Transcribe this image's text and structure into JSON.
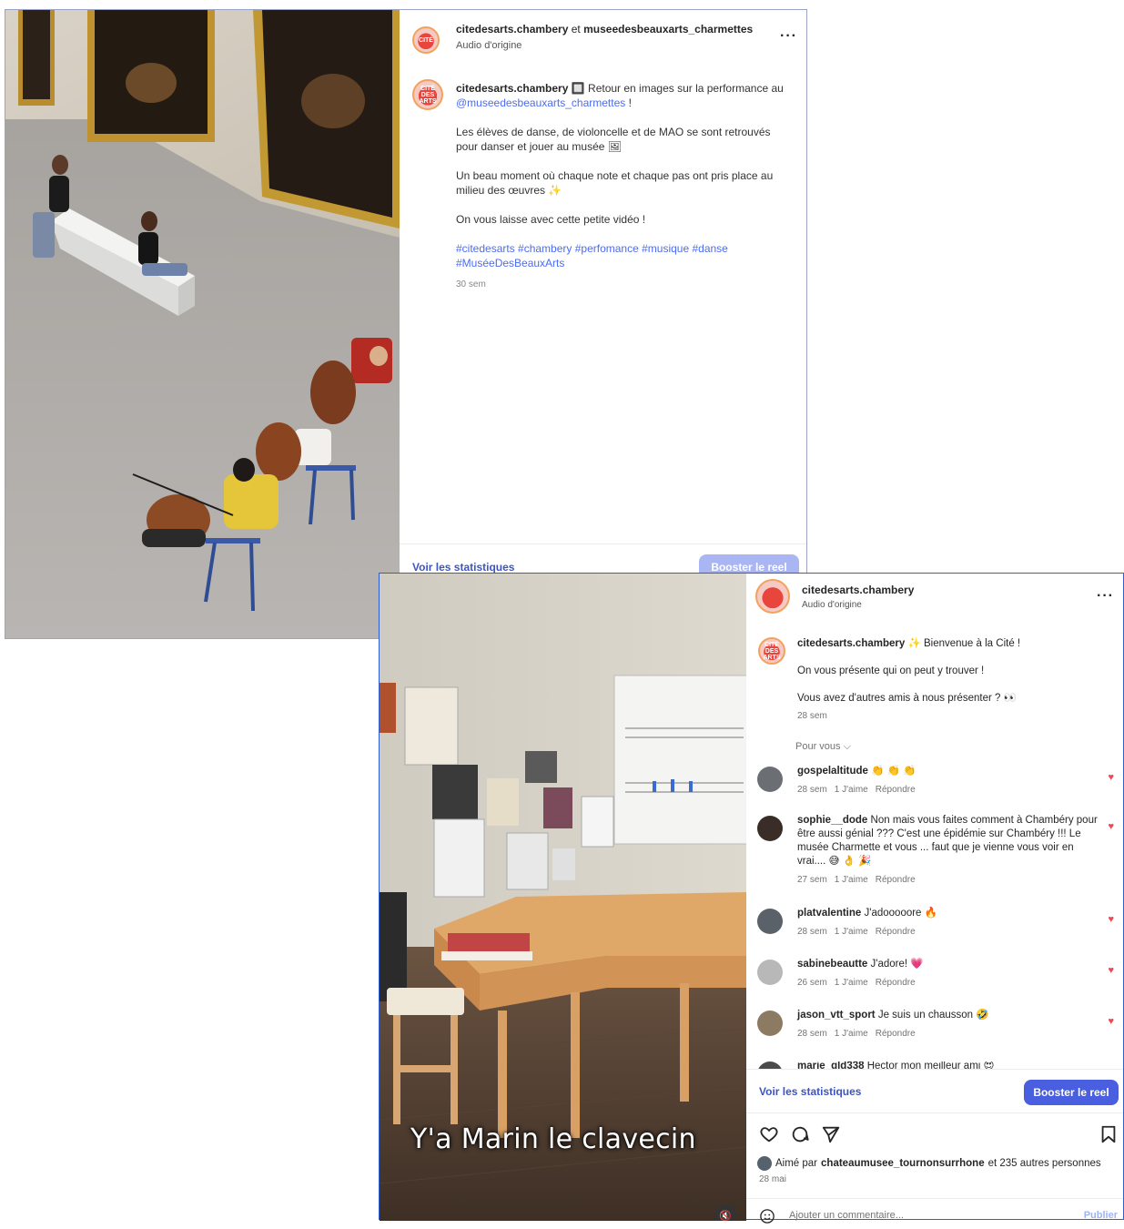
{
  "post1": {
    "header": {
      "author": "citedesarts.chambery",
      "joiner": "et",
      "coauthor": "museedesbeauxarts_charmettes",
      "audio": "Audio d'origine"
    },
    "caption": {
      "author": "citedesarts.chambery",
      "line1": "🔲 Retour en images sur la performance au",
      "mention": "@museedesbeauxarts_charmettes",
      "line1_end": "!",
      "para2": "Les élèves de danse, de violoncelle et de MAO se sont retrouvés pour danser et jouer au musée 🖼",
      "para3": "Un beau moment où chaque note et chaque pas ont pris place au milieu des œuvres ✨",
      "para4": "On vous laisse avec cette petite vidéo !",
      "hashtags": "#citedesarts #chambery #perfomance #musique #danse #MuséeDesBeauxArts",
      "time": "30 sem"
    },
    "stats_link": "Voir les statistiques",
    "boost_label": "Booster le reel",
    "boost_color": "#a9b6f3"
  },
  "post2": {
    "header": {
      "author": "citedesarts.chambery",
      "audio": "Audio d'origine"
    },
    "caption": {
      "author": "citedesarts.chambery",
      "line1": "✨ Bienvenue à la Cité !",
      "para2": "On vous présente qui on peut y trouver !",
      "para3": "Vous avez d'autres amis à nous présenter ? 👀",
      "time": "28 sem"
    },
    "for_you": "Pour vous ⌵",
    "comments": [
      {
        "user": "gospelaltitude",
        "text": "👏 👏 👏",
        "time": "28 sem",
        "likes": "1 J'aime",
        "reply": "Répondre"
      },
      {
        "user": "sophie__dode",
        "text": "Non mais vous faites comment à Chambéry pour être aussi génial ??? C'est une épidémie sur Chambéry !!! Le musée Charmette et vous ... faut que je vienne vous voir en vrai.... 😅 👌 🎉",
        "time": "27 sem",
        "likes": "1 J'aime",
        "reply": "Répondre"
      },
      {
        "user": "platvalentine",
        "text": "J'adooooore 🔥",
        "time": "28 sem",
        "likes": "1 J'aime",
        "reply": "Répondre"
      },
      {
        "user": "sabinebeautte",
        "text": "J'adore! 💗",
        "time": "26 sem",
        "likes": "1 J'aime",
        "reply": "Répondre"
      },
      {
        "user": "jason_vtt_sport",
        "text": "Je suis un chausson 🤣",
        "time": "28 sem",
        "likes": "1 J'aime",
        "reply": "Répondre"
      },
      {
        "user": "marie_gld338",
        "text": "Hector mon meilleur ami 😍",
        "time": "",
        "likes": "",
        "reply": ""
      }
    ],
    "video_overlay": "Y'a Marin le clavecin",
    "stats_link": "Voir les statistiques",
    "boost_label": "Booster le reel",
    "boost_color": "#4a5fe0",
    "liked_by_prefix": "Aimé par",
    "liked_by_user": "chateaumusee_tournonsurrhone",
    "liked_by_suffix": "et 235 autres personnes",
    "date": "28 mai",
    "comment_placeholder": "Ajouter un commentaire...",
    "publish_label": "Publier"
  },
  "icons": [
    "heart-icon",
    "comment-icon",
    "share-icon",
    "bookmark-icon",
    "more-icon",
    "emoji-icon",
    "mute-icon"
  ]
}
